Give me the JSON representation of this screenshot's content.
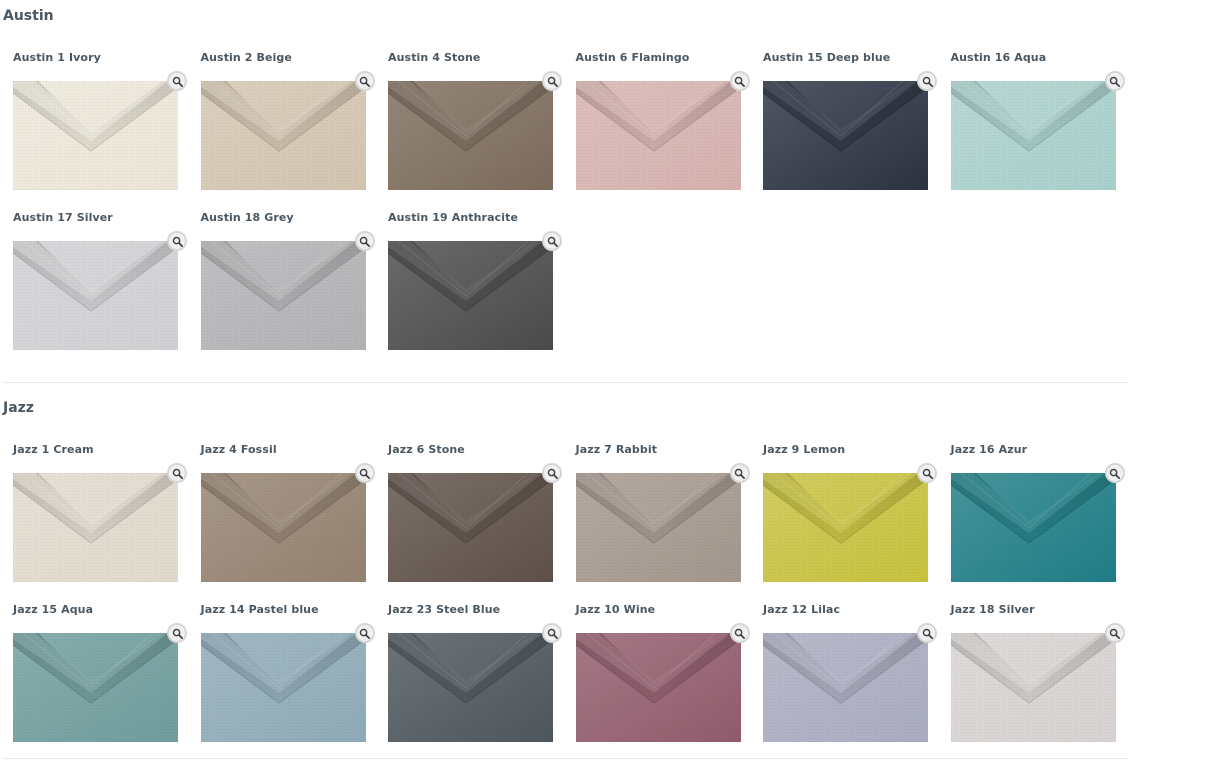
{
  "sections": [
    {
      "title": "Austin",
      "swatches": [
        {
          "label": "Austin 1 Ivory",
          "color": "#ece6d8"
        },
        {
          "label": "Austin 2 Beige",
          "color": "#d3c4b0"
        },
        {
          "label": "Austin 4 Stone",
          "color": "#7c6b5c"
        },
        {
          "label": "Austin 6 Flamingo",
          "color": "#d5b1ae"
        },
        {
          "label": "Austin 15 Deep blue",
          "color": "#2b3242"
        },
        {
          "label": "Austin 16 Aqua",
          "color": "#a8d0cb"
        },
        {
          "label": "Austin 17 Silver",
          "color": "#d0d0d3"
        },
        {
          "label": "Austin 18 Grey",
          "color": "#b2b2b5"
        },
        {
          "label": "Austin 19 Anthracite",
          "color": "#4b4a4c"
        }
      ]
    },
    {
      "title": "Jazz",
      "swatches": [
        {
          "label": "Jazz 1 Cream",
          "color": "#e0d9cc"
        },
        {
          "label": "Jazz 4 Fossil",
          "color": "#94816f"
        },
        {
          "label": "Jazz 6 Stone",
          "color": "#5e5048"
        },
        {
          "label": "Jazz 7 Rabbit",
          "color": "#a3968c"
        },
        {
          "label": "Jazz 9 Lemon",
          "color": "#c7c13e"
        },
        {
          "label": "Jazz 16 Azur",
          "color": "#1f7d86"
        },
        {
          "label": "Jazz 15 Aqua",
          "color": "#6f9c9c"
        },
        {
          "label": "Jazz 14 Pastel blue",
          "color": "#8eaab7"
        },
        {
          "label": "Jazz 23 Steel Blue",
          "color": "#4d565c"
        },
        {
          "label": "Jazz 10 Wine",
          "color": "#915b6c"
        },
        {
          "label": "Jazz 12 Lilac",
          "color": "#a9abbf"
        },
        {
          "label": "Jazz 18 Silver",
          "color": "#d6d2d1"
        }
      ]
    }
  ]
}
